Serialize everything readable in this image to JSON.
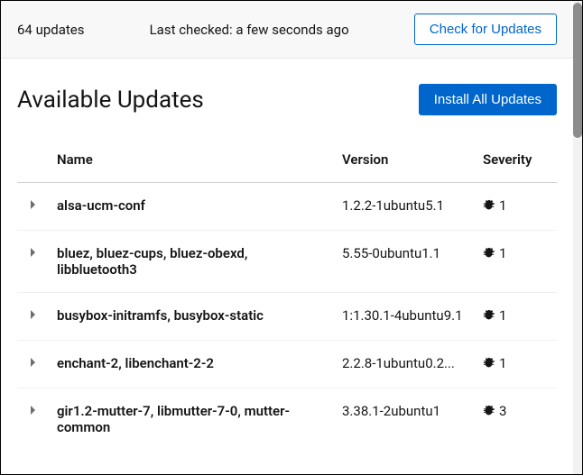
{
  "header": {
    "count_label": "64 updates",
    "last_checked": "Last checked: a few seconds ago",
    "check_button": "Check for Updates"
  },
  "main": {
    "title": "Available Updates",
    "install_button": "Install All Updates"
  },
  "table": {
    "columns": {
      "name": "Name",
      "version": "Version",
      "severity": "Severity"
    },
    "rows": [
      {
        "name": "alsa-ucm-conf",
        "version": "1.2.2-1ubuntu5.1",
        "severity": "1"
      },
      {
        "name": "bluez, bluez-cups, bluez-obexd, libbluetooth3",
        "version": "5.55-0ubuntu1.1",
        "severity": "1"
      },
      {
        "name": "busybox-initramfs, busybox-static",
        "version": "1:1.30.1-4ubuntu9.1",
        "severity": "1"
      },
      {
        "name": "enchant-2, libenchant-2-2",
        "version": "2.2.8-1ubuntu0.2...",
        "severity": "1"
      },
      {
        "name": "gir1.2-mutter-7, libmutter-7-0, mutter-common",
        "version": "3.38.1-2ubuntu1",
        "severity": "3"
      }
    ]
  }
}
